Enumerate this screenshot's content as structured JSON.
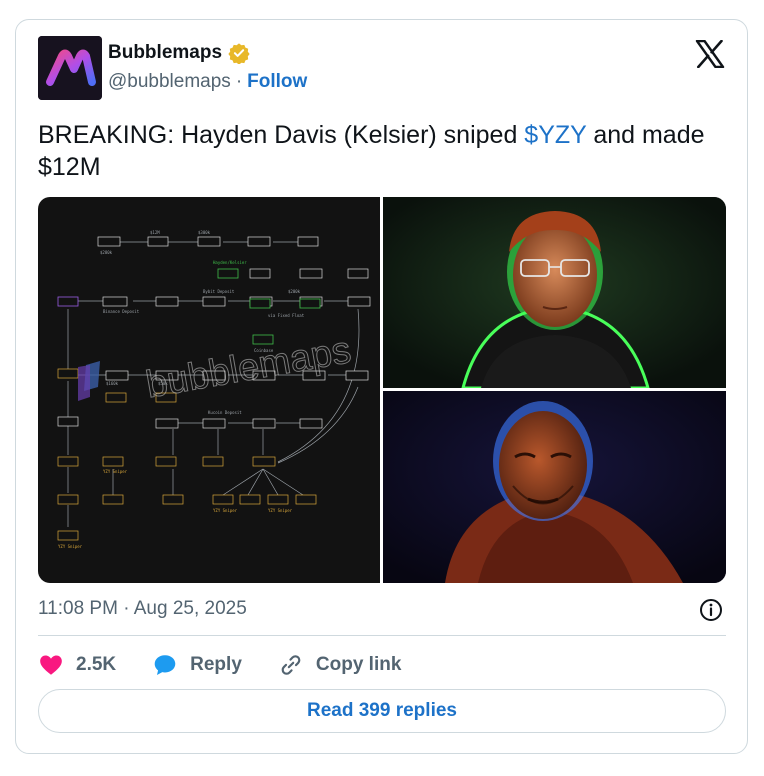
{
  "author": {
    "name": "Bubblemaps",
    "handle": "@bubblemaps",
    "separator": "·",
    "follow_label": "Follow",
    "verified": true,
    "verified_color": "#e8b829",
    "avatar_icon": "bubblemaps-logo"
  },
  "tweet": {
    "text_before": "BREAKING: Hayden Davis (Kelsier) sniped ",
    "cashtag": "$YZY",
    "text_after": " and made $12M"
  },
  "media": {
    "watermark": "bubblemaps",
    "flowchart_labels": [
      "Binance Deposit",
      "Bybit Deposit",
      "Kucoin Deposit",
      "YZY Sniper",
      "Funded",
      "Hayden/Kelsier",
      "via Fixed Float",
      "Coinbase"
    ],
    "flowchart_values": [
      "$280k",
      "$12M",
      "$300k",
      "$160k",
      "$50k",
      "$200k"
    ],
    "top_right_alt": "portrait-green-glow",
    "bottom_right_alt": "portrait-blue-glow"
  },
  "timestamp": "11:08 PM · Aug 25, 2025",
  "actions": {
    "like_count": "2.5K",
    "reply_label": "Reply",
    "copy_link_label": "Copy link"
  },
  "read_replies_label": "Read 399 replies",
  "colors": {
    "link": "#1d72c8",
    "like": "#f91880",
    "reply": "#1d9bf0",
    "muted": "#536471"
  }
}
